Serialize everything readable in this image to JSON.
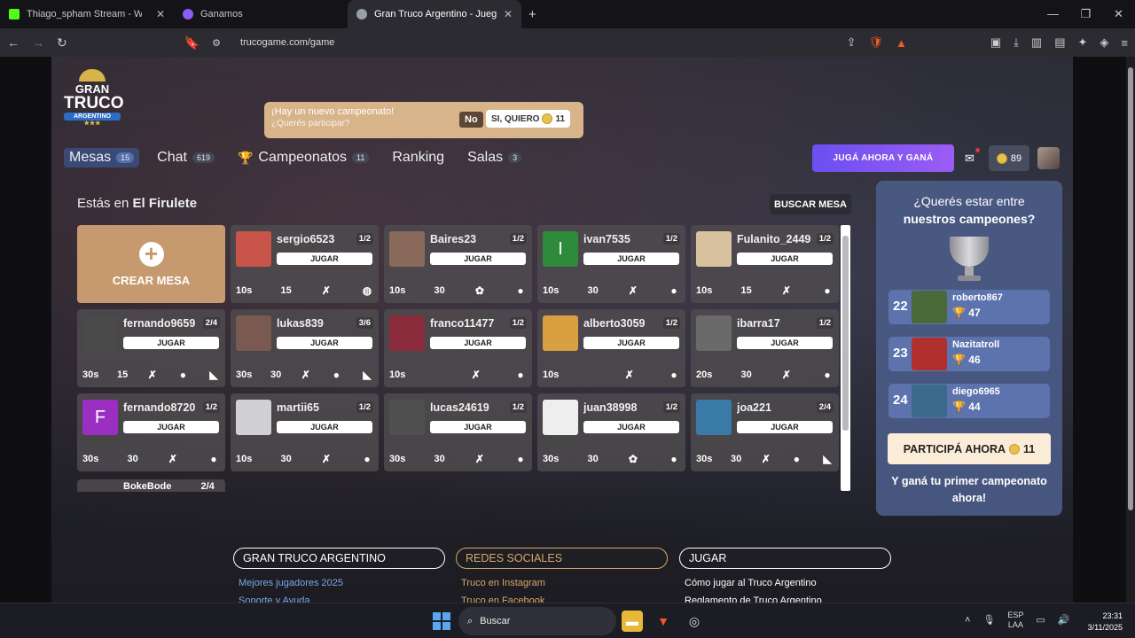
{
  "browser": {
    "tabs": [
      {
        "title": "Thiago_spham Stream - Watch Li",
        "icon": "kick-icon",
        "color": "#53fc18"
      },
      {
        "title": "Ganamos",
        "icon": "ganamos-icon",
        "color": "#8b5cf6"
      },
      {
        "title": "Gran Truco Argentino - Juego Or",
        "icon": "truco-icon",
        "color": "#9aa0a8"
      }
    ],
    "url": "trucogame.com/game"
  },
  "logo": {
    "line1": "GRAN",
    "line2": "TRUCO",
    "line3": "ARGENTINO",
    "stars": "★★★"
  },
  "notification": {
    "title": "¡Hay un nuevo campeonato!",
    "question": "¿Querés participar?",
    "no": "No",
    "yes": "SI, QUIERO",
    "yes_coins": "11"
  },
  "nav": [
    {
      "label": "Mesas",
      "badge": "15"
    },
    {
      "label": "Chat",
      "badge": "619"
    },
    {
      "label": "Campeonatos",
      "badge": "11"
    },
    {
      "label": "Ranking",
      "badge": ""
    },
    {
      "label": "Salas",
      "badge": "3"
    }
  ],
  "header_right": {
    "play_now": "JUGÁ AHORA Y GANÁ",
    "coins": "89"
  },
  "location": {
    "prefix": "Estás en",
    "name": "El Firulete"
  },
  "search_table": "BUSCAR MESA",
  "create_table": "CREAR MESA",
  "join_label": "JUGAR",
  "tables": [
    {
      "user": "sergio6523",
      "count": "1/2",
      "time": "10s",
      "points": "15",
      "avatar_color": "#c9554a",
      "avatar_letter": "",
      "extras": [
        "no-flor-icon",
        "chat-off-icon"
      ]
    },
    {
      "user": "Baires23",
      "count": "1/2",
      "time": "10s",
      "points": "30",
      "avatar_color": "#8a6a5a",
      "avatar_letter": "",
      "extras": [
        "flor-icon",
        "chat-icon"
      ]
    },
    {
      "user": "ivan7535",
      "count": "1/2",
      "time": "10s",
      "points": "30",
      "avatar_color": "#2e8b3c",
      "avatar_letter": "I",
      "extras": [
        "no-flor-icon",
        "chat-icon"
      ]
    },
    {
      "user": "Fulanito_2449",
      "count": "1/2",
      "time": "10s",
      "points": "15",
      "avatar_color": "#d9c2a0",
      "avatar_letter": "",
      "extras": [
        "no-flor-icon",
        "chat-icon"
      ]
    },
    {
      "user": "fernando9659",
      "count": "2/4",
      "time": "30s",
      "points": "15",
      "avatar_color": "#4a4a4a",
      "avatar_letter": "",
      "extras": [
        "no-flor-icon",
        "chat-icon",
        "shoe-icon"
      ]
    },
    {
      "user": "lukas839",
      "count": "3/6",
      "time": "30s",
      "points": "30",
      "avatar_color": "#7a5a50",
      "avatar_letter": "",
      "extras": [
        "no-flor-icon",
        "chat-icon",
        "shoe-icon"
      ]
    },
    {
      "user": "franco11477",
      "count": "1/2",
      "time": "10s",
      "points": "",
      "avatar_color": "#8b2c3c",
      "avatar_letter": "",
      "extras": [
        "no-flor-icon",
        "chat-icon"
      ]
    },
    {
      "user": "alberto3059",
      "count": "1/2",
      "time": "10s",
      "points": "",
      "avatar_color": "#d8a040",
      "avatar_letter": "",
      "extras": [
        "no-flor-icon",
        "chat-icon"
      ]
    },
    {
      "user": "ibarra17",
      "count": "1/2",
      "time": "20s",
      "points": "30",
      "avatar_color": "#6a6a6a",
      "avatar_letter": "",
      "extras": [
        "no-flor-icon",
        "chat-icon"
      ]
    },
    {
      "user": "fernando8720",
      "count": "1/2",
      "time": "30s",
      "points": "30",
      "avatar_color": "#9b2fc2",
      "avatar_letter": "F",
      "extras": [
        "no-flor-icon",
        "chat-icon"
      ]
    },
    {
      "user": "martii65",
      "count": "1/2",
      "time": "10s",
      "points": "30",
      "avatar_color": "#d0d0d4",
      "avatar_letter": "",
      "extras": [
        "no-flor-icon",
        "chat-icon"
      ]
    },
    {
      "user": "lucas24619",
      "count": "1/2",
      "time": "30s",
      "points": "30",
      "avatar_color": "#505050",
      "avatar_letter": "",
      "extras": [
        "no-flor-icon",
        "chat-icon"
      ]
    },
    {
      "user": "juan38998",
      "count": "1/2",
      "time": "30s",
      "points": "30",
      "avatar_color": "#eeeeee",
      "avatar_letter": "",
      "extras": [
        "flor-icon",
        "chat-icon"
      ]
    },
    {
      "user": "joa221",
      "count": "2/4",
      "time": "30s",
      "points": "30",
      "avatar_color": "#3a7aa8",
      "avatar_letter": "",
      "extras": [
        "no-flor-icon",
        "chat-icon",
        "shoe-icon"
      ]
    }
  ],
  "partial_table": {
    "user": "BokeBode",
    "count": "2/4"
  },
  "champions": {
    "title1": "¿Querés estar entre",
    "title2": "nuestros campeones?",
    "ranking": [
      {
        "pos": "22",
        "user": "roberto867",
        "score": "47",
        "color": "#4a6a3a"
      },
      {
        "pos": "23",
        "user": "Nazitatroll",
        "score": "46",
        "color": "#b03030"
      },
      {
        "pos": "24",
        "user": "diego6965",
        "score": "44",
        "color": "#3a6a8a"
      }
    ],
    "cta": "PARTICIPÁ AHORA",
    "cta_coins": "11",
    "subtitle": "Y ganá tu primer campeonato ahora!"
  },
  "footer": [
    {
      "heading": "GRAN TRUCO ARGENTINO",
      "link1": "Mejores jugadores 2025",
      "link2": "Soporte y Ayuda"
    },
    {
      "heading": "REDES SOCIALES",
      "link1": "Truco en Instagram",
      "link2": "Truco en Facebook"
    },
    {
      "heading": "JUGAR",
      "link1": "Cómo jugar al Truco Argentino",
      "link2": "Reglamento de Truco Argentino"
    }
  ],
  "taskbar": {
    "search": "Buscar",
    "lang1": "ESP",
    "lang2": "LAA",
    "time": "23:31",
    "date": "3/11/2025"
  }
}
